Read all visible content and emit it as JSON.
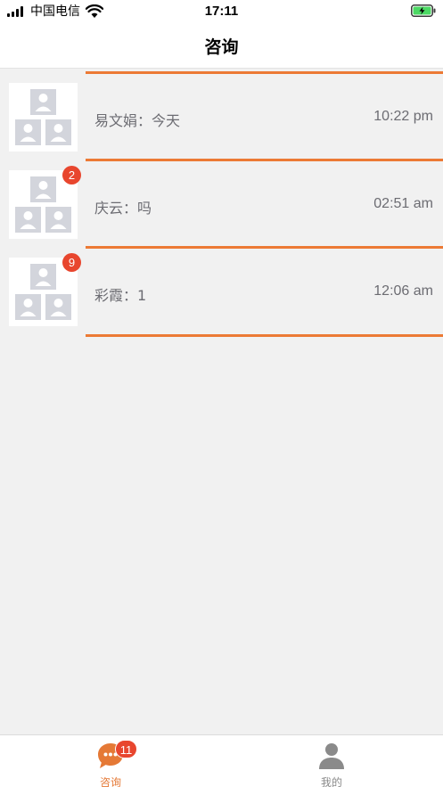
{
  "status_bar": {
    "carrier": "中国电信",
    "time": "17:11"
  },
  "nav": {
    "title": "咨询"
  },
  "conversations": [
    {
      "name": "易文娟",
      "message": "易文娟：今天",
      "time": "10:22 pm",
      "unread": ""
    },
    {
      "name": "庆云",
      "message": "庆云：吗",
      "time": "02:51 am",
      "unread": "2"
    },
    {
      "name": "彩霞",
      "message": "彩霞：1",
      "time": "12:06 am",
      "unread": "9"
    }
  ],
  "tab_bar": {
    "consult_label": "咨询",
    "consult_badge": "11",
    "mine_label": "我的"
  },
  "colors": {
    "accent": "#ec7a35",
    "badge": "#e8462e",
    "avatar_placeholder": "#d3d5dc",
    "background": "#f1f1f1"
  },
  "icons": {
    "consult_tab": "chat-bubble-icon",
    "mine_tab": "person-icon",
    "avatar": "group-avatar-icon"
  }
}
